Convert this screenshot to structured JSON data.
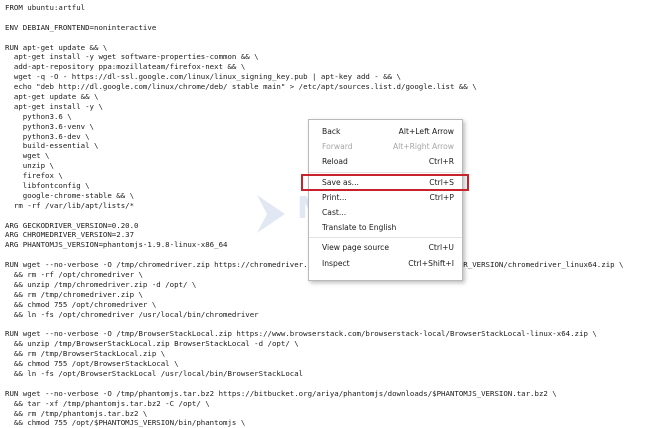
{
  "code_lines": [
    "FROM ubuntu:artful",
    "",
    "ENV DEBIAN_FRONTEND=noninteractive",
    "",
    "RUN apt-get update && \\",
    "  apt-get install -y wget software-properties-common && \\",
    "  add-apt-repository ppa:mozillateam/firefox-next && \\",
    "  wget -q -O - https://dl-ssl.google.com/linux/linux_signing_key.pub | apt-key add - && \\",
    "  echo \"deb http://dl.google.com/linux/chrome/deb/ stable main\" > /etc/apt/sources.list.d/google.list && \\",
    "  apt-get update && \\",
    "  apt-get install -y \\",
    "    python3.6 \\",
    "    python3.6-venv \\",
    "    python3.6-dev \\",
    "    build-essential \\",
    "    wget \\",
    "    unzip \\",
    "    firefox \\",
    "    libfontconfig \\",
    "    google-chrome-stable && \\",
    "  rm -rf /var/lib/apt/lists/*",
    "",
    "ARG GECKODRIVER_VERSION=0.20.0",
    "ARG CHROMEDRIVER_VERSION=2.37",
    "ARG PHANTOMJS_VERSION=phantomjs-1.9.8-linux-x86_64",
    "",
    "RUN wget --no-verbose -O /tmp/chromedriver.zip https://chromedriver.storage.googleapis.com/$CHROMEDRIVER_VERSION/chromedriver_linux64.zip \\",
    "  && rm -rf /opt/chromedriver \\",
    "  && unzip /tmp/chromedriver.zip -d /opt/ \\",
    "  && rm /tmp/chromedriver.zip \\",
    "  && chmod 755 /opt/chromedriver \\",
    "  && ln -fs /opt/chromedriver /usr/local/bin/chromedriver",
    "",
    "RUN wget --no-verbose -O /tmp/BrowserStackLocal.zip https://www.browserstack.com/browserstack-local/BrowserStackLocal-linux-x64.zip \\",
    "  && unzip /tmp/BrowserStackLocal.zip BrowserStackLocal -d /opt/ \\",
    "  && rm /tmp/BrowserStackLocal.zip \\",
    "  && chmod 755 /opt/BrowserStackLocal \\",
    "  && ln -fs /opt/BrowserStackLocal /usr/local/bin/BrowserStackLocal",
    "",
    "RUN wget --no-verbose -O /tmp/phantomjs.tar.bz2 https://bitbucket.org/ariya/phantomjs/downloads/$PHANTOMJS_VERSION.tar.bz2 \\",
    "  && tar -xf /tmp/phantomjs.tar.bz2 -C /opt/ \\",
    "  && rm /tmp/phantomjs.tar.bz2 \\",
    "  && chmod 755 /opt/$PHANTOMJS_VERSION/bin/phantomjs \\"
  ],
  "watermark": {
    "text": "NESABA",
    "sub": "MEDIA.COM"
  },
  "context_menu": {
    "back": {
      "label": "Back",
      "shortcut": "Alt+Left Arrow"
    },
    "forward": {
      "label": "Forward",
      "shortcut": "Alt+Right Arrow"
    },
    "reload": {
      "label": "Reload",
      "shortcut": "Ctrl+R"
    },
    "save_as": {
      "label": "Save as...",
      "shortcut": "Ctrl+S"
    },
    "print": {
      "label": "Print...",
      "shortcut": "Ctrl+P"
    },
    "cast": {
      "label": "Cast..."
    },
    "translate": {
      "label": "Translate to English"
    },
    "view_source": {
      "label": "View page source",
      "shortcut": "Ctrl+U"
    },
    "inspect": {
      "label": "Inspect",
      "shortcut": "Ctrl+Shift+I"
    }
  },
  "colors": {
    "highlight_border": "#c8232c",
    "disabled_text": "#a6a6a6"
  }
}
